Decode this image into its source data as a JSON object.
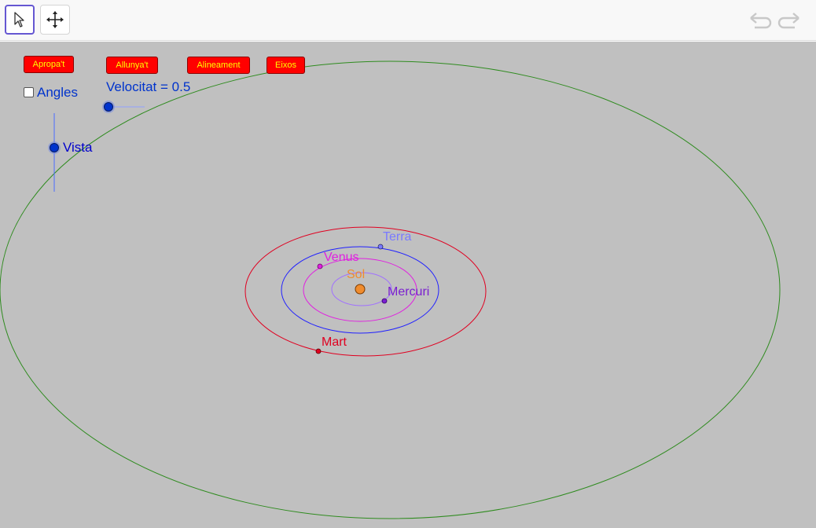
{
  "toolbar": {
    "tools": [
      {
        "name": "select",
        "icon": "arrow-cursor-icon",
        "active": true
      },
      {
        "name": "move-view",
        "icon": "move-arrows-icon",
        "active": false
      }
    ],
    "undo_icon": "undo-icon",
    "redo_icon": "redo-icon"
  },
  "buttons": {
    "apropat": "Apropa't",
    "allunyat": "Allunya't",
    "alineament": "Alineament",
    "eixos": "Eixos"
  },
  "angles": {
    "label": "Angles",
    "checked": false
  },
  "velocitat": {
    "label": "Velocitat = 0.5",
    "value": 0.5
  },
  "vista": {
    "label": "Vista"
  },
  "bodies": {
    "sol": "Sol",
    "mercuri": "Mercuri",
    "venus": "Venus",
    "terra": "Terra",
    "mart": "Mart"
  },
  "colors": {
    "canvas_bg": "#c0c0c0",
    "button_bg": "#ff0000",
    "button_text": "#ffff00",
    "slider": "#0000cc",
    "sun": "#f08c2e",
    "mercury_orbit": "#a070ff",
    "mercury": "#7a1fd0",
    "venus": "#e020e0",
    "earth_orbit": "#2020ff",
    "earth_label": "#7a7aff",
    "mars": "#e00020",
    "outer_orbit": "#2e8b1e"
  }
}
